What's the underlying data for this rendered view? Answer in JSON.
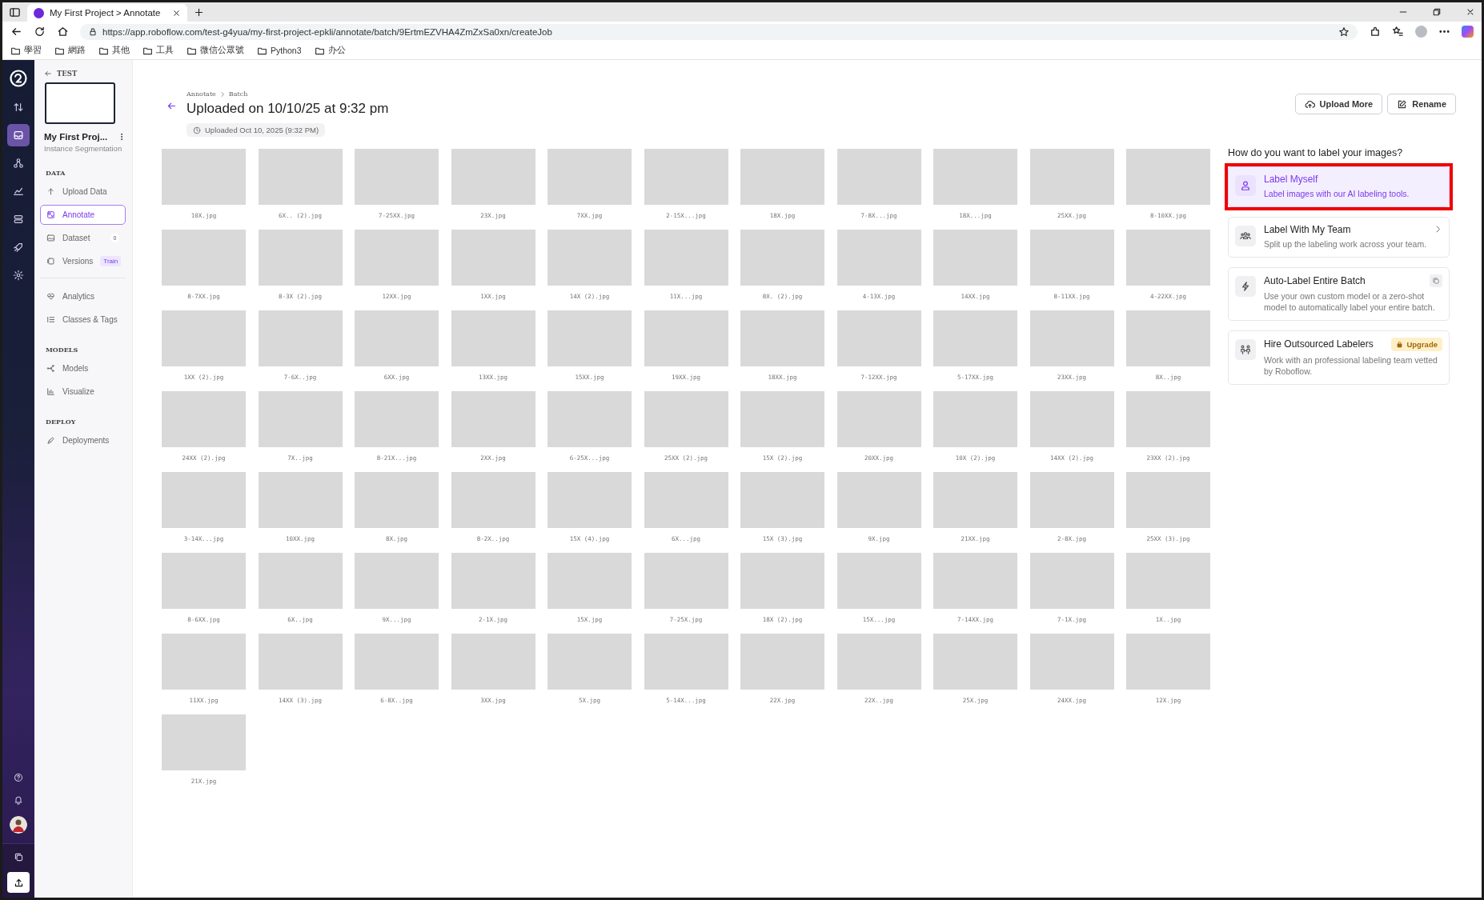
{
  "browser": {
    "tab_title": "My First Project > Annotate",
    "url": "https://app.roboflow.com/test-g4yua/my-first-project-epkli/annotate/batch/9ErtmEZVHA4ZmZxSa0xn/createJob",
    "bookmarks": [
      "學習",
      "網路",
      "其他",
      "工具",
      "微信公眾號",
      "Python3",
      "办公"
    ]
  },
  "rail": {
    "items": [
      {
        "selected": false
      },
      {
        "selected": true
      },
      {
        "selected": false
      },
      {
        "selected": false
      },
      {
        "selected": false
      },
      {
        "selected": false
      },
      {
        "selected": false
      }
    ]
  },
  "sidebar": {
    "back_label": "TEST",
    "project_name": "My First Proj...",
    "project_type": "Instance Segmentation",
    "sections": [
      {
        "title": "DATA",
        "items": [
          {
            "label": "Upload Data",
            "selected": false
          },
          {
            "label": "Annotate",
            "selected": true
          },
          {
            "label": "Dataset",
            "selected": false,
            "badge": {
              "text": "0",
              "kind": "count"
            }
          },
          {
            "label": "Versions",
            "selected": false,
            "badge": {
              "text": "Train",
              "kind": "tag"
            }
          }
        ]
      },
      {
        "items": [
          {
            "label": "Analytics",
            "selected": false
          },
          {
            "label": "Classes & Tags",
            "selected": false
          }
        ]
      },
      {
        "title": "MODELS",
        "items": [
          {
            "label": "Models",
            "selected": false
          },
          {
            "label": "Visualize",
            "selected": false
          }
        ]
      },
      {
        "title": "DEPLOY",
        "items": [
          {
            "label": "Deployments",
            "selected": false
          }
        ]
      }
    ]
  },
  "header": {
    "breadcrumb": [
      "Annotate",
      "Batch"
    ],
    "title": "Uploaded on 10/10/25 at 9:32 pm",
    "uploaded": "Uploaded Oct 10, 2025 (9:32 PM)",
    "buttons": [
      "Upload More",
      "Rename"
    ]
  },
  "images": [
    "10X.jpg",
    "6X.. (2).jpg",
    "7-25XX.jpg",
    "23X.jpg",
    "7XX.jpg",
    "2-15X...jpg",
    "18X.jpg",
    "7-8X...jpg",
    "18X...jpg",
    "25XX.jpg",
    "8-10XX.jpg",
    "8-7XX.jpg",
    "8-3X (2).jpg",
    "12XX.jpg",
    "1XX.jpg",
    "14X (2).jpg",
    "11X...jpg",
    "8X. (2).jpg",
    "4-13X.jpg",
    "14XX.jpg",
    "8-11XX.jpg",
    "4-22XX.jpg",
    "1XX (2).jpg",
    "7-6X..jpg",
    "6XX.jpg",
    "13XX.jpg",
    "15XX.jpg",
    "19XX.jpg",
    "18XX.jpg",
    "7-12XX.jpg",
    "5-17XX.jpg",
    "23XX.jpg",
    "8X..jpg",
    "24XX (2).jpg",
    "7X..jpg",
    "8-21X...jpg",
    "2XX.jpg",
    "6-25X...jpg",
    "25XX (2).jpg",
    "15X (2).jpg",
    "20XX.jpg",
    "10X (2).jpg",
    "14XX (2).jpg",
    "23XX (2).jpg",
    "3-14X...jpg",
    "10XX.jpg",
    "8X.jpg",
    "8-2X..jpg",
    "15X (4).jpg",
    "6X...jpg",
    "15X (3).jpg",
    "9X.jpg",
    "21XX.jpg",
    "2-8X.jpg",
    "25XX (3).jpg",
    "8-6XX.jpg",
    "6X..jpg",
    "9X...jpg",
    "2-1X.jpg",
    "15X.jpg",
    "7-25X.jpg",
    "18X (2).jpg",
    "15X...jpg",
    "7-14XX.jpg",
    "7-1X.jpg",
    "1X..jpg",
    "11XX.jpg",
    "14XX (3).jpg",
    "6-8X..jpg",
    "3XX.jpg",
    "5X.jpg",
    "5-14X...jpg",
    "22X.jpg",
    "22X..jpg",
    "25X.jpg",
    "24XX.jpg",
    "12X.jpg",
    "21X.jpg"
  ],
  "labeling": {
    "question": "How do you want to label your images?",
    "options": [
      {
        "title": "Label Myself",
        "description": "Label images with our AI labeling tools.",
        "selected": true,
        "highlighted": true
      },
      {
        "title": "Label With My Team",
        "description": "Split up the labeling work across your team.",
        "selected": false,
        "highlighted": false
      },
      {
        "title": "Auto-Label Entire Batch",
        "description": "Use your own custom model or a zero-shot model to automatically label your entire batch.",
        "selected": false,
        "highlighted": false
      },
      {
        "title": "Hire Outsourced Labelers",
        "description": "Work with an professional labeling team vetted by Roboflow.",
        "selected": false,
        "highlighted": false,
        "badge": "Upgrade"
      }
    ]
  }
}
